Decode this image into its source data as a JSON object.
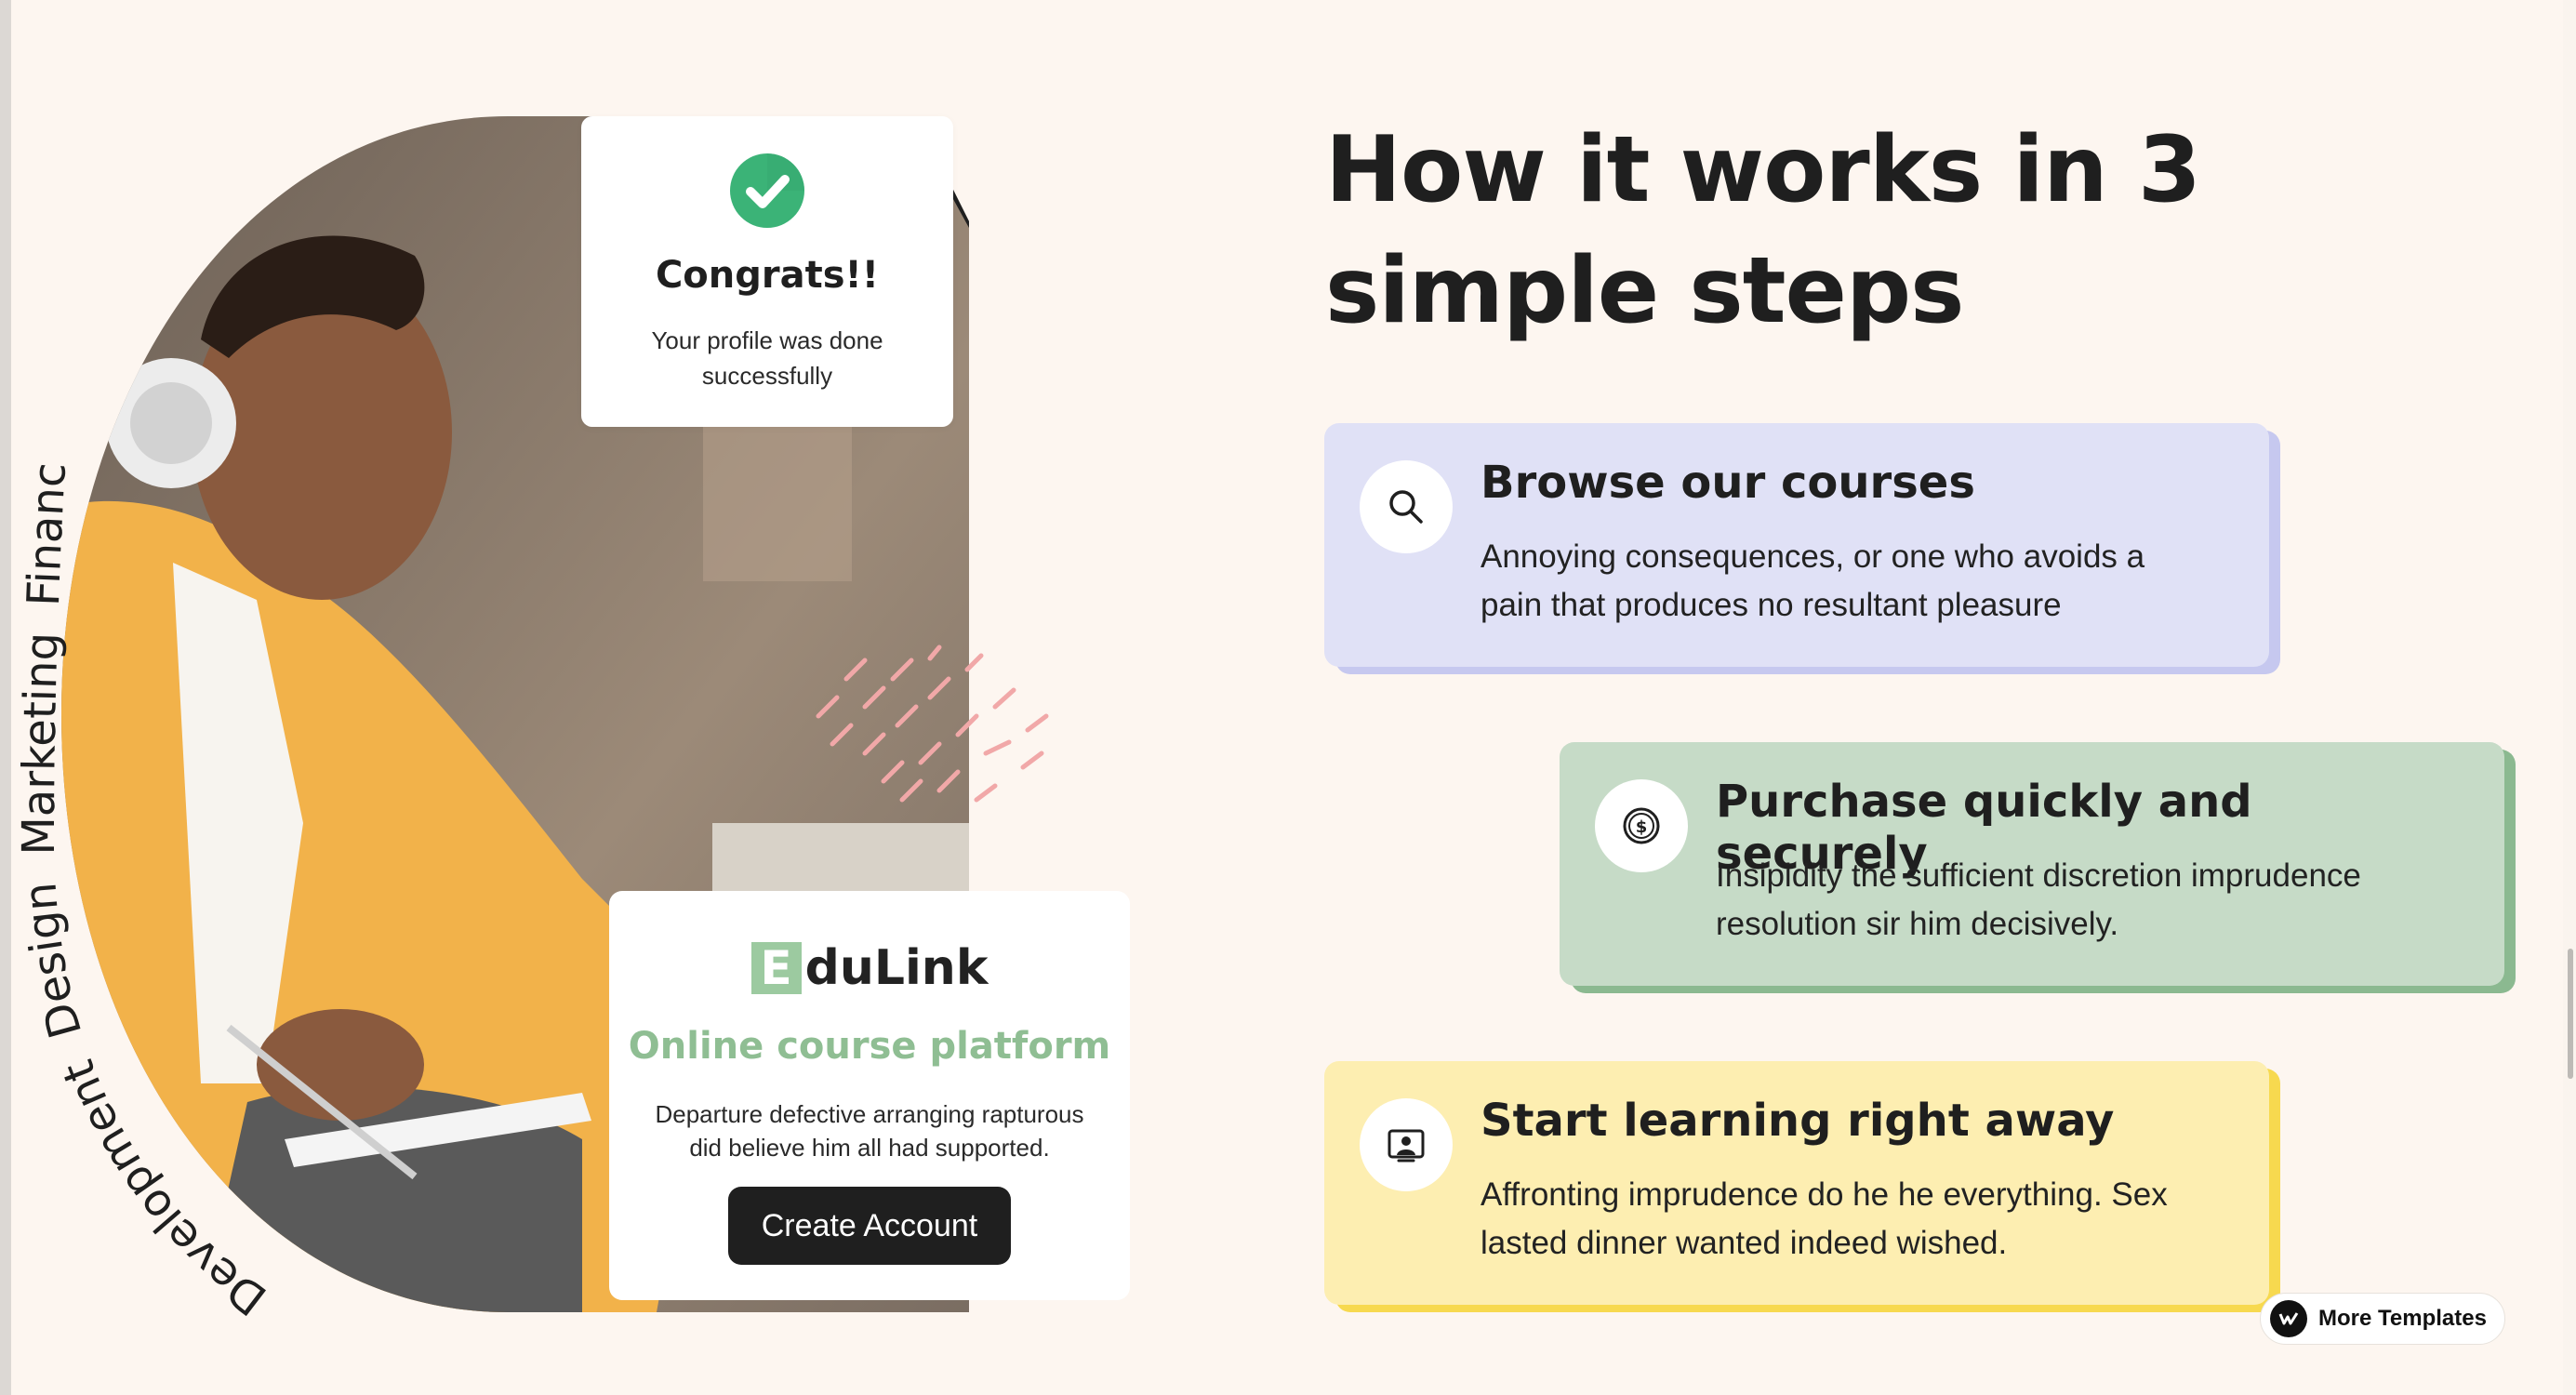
{
  "categories": [
    "Development",
    "Design",
    "Marketing",
    "Finance"
  ],
  "congrats": {
    "title": "Congrats!!",
    "message": "Your profile was done successfully"
  },
  "edulink": {
    "logo_mark": "E",
    "logo_text": "duLink",
    "tagline": "Online course platform",
    "description": "Departure defective arranging rapturous did believe him all had supported.",
    "cta_label": "Create Account"
  },
  "headline": "How it works in 3 simple steps",
  "steps": [
    {
      "icon": "search-icon",
      "title": "Browse our courses",
      "text": "Annoying consequences, or one who avoids a pain that produces no resultant pleasure",
      "color": "#e0e1f6"
    },
    {
      "icon": "dollar-coin-icon",
      "title": "Purchase quickly and securely",
      "text": "Insipidity the sufficient discretion imprudence resolution sir him decisively.",
      "color": "#c6dbc7"
    },
    {
      "icon": "presentation-user-icon",
      "title": "Start learning right away",
      "text": "Affronting imprudence do he he everything. Sex lasted dinner wanted indeed wished.",
      "color": "#fdeeb1"
    }
  ],
  "badge": {
    "label": "More Templates"
  }
}
